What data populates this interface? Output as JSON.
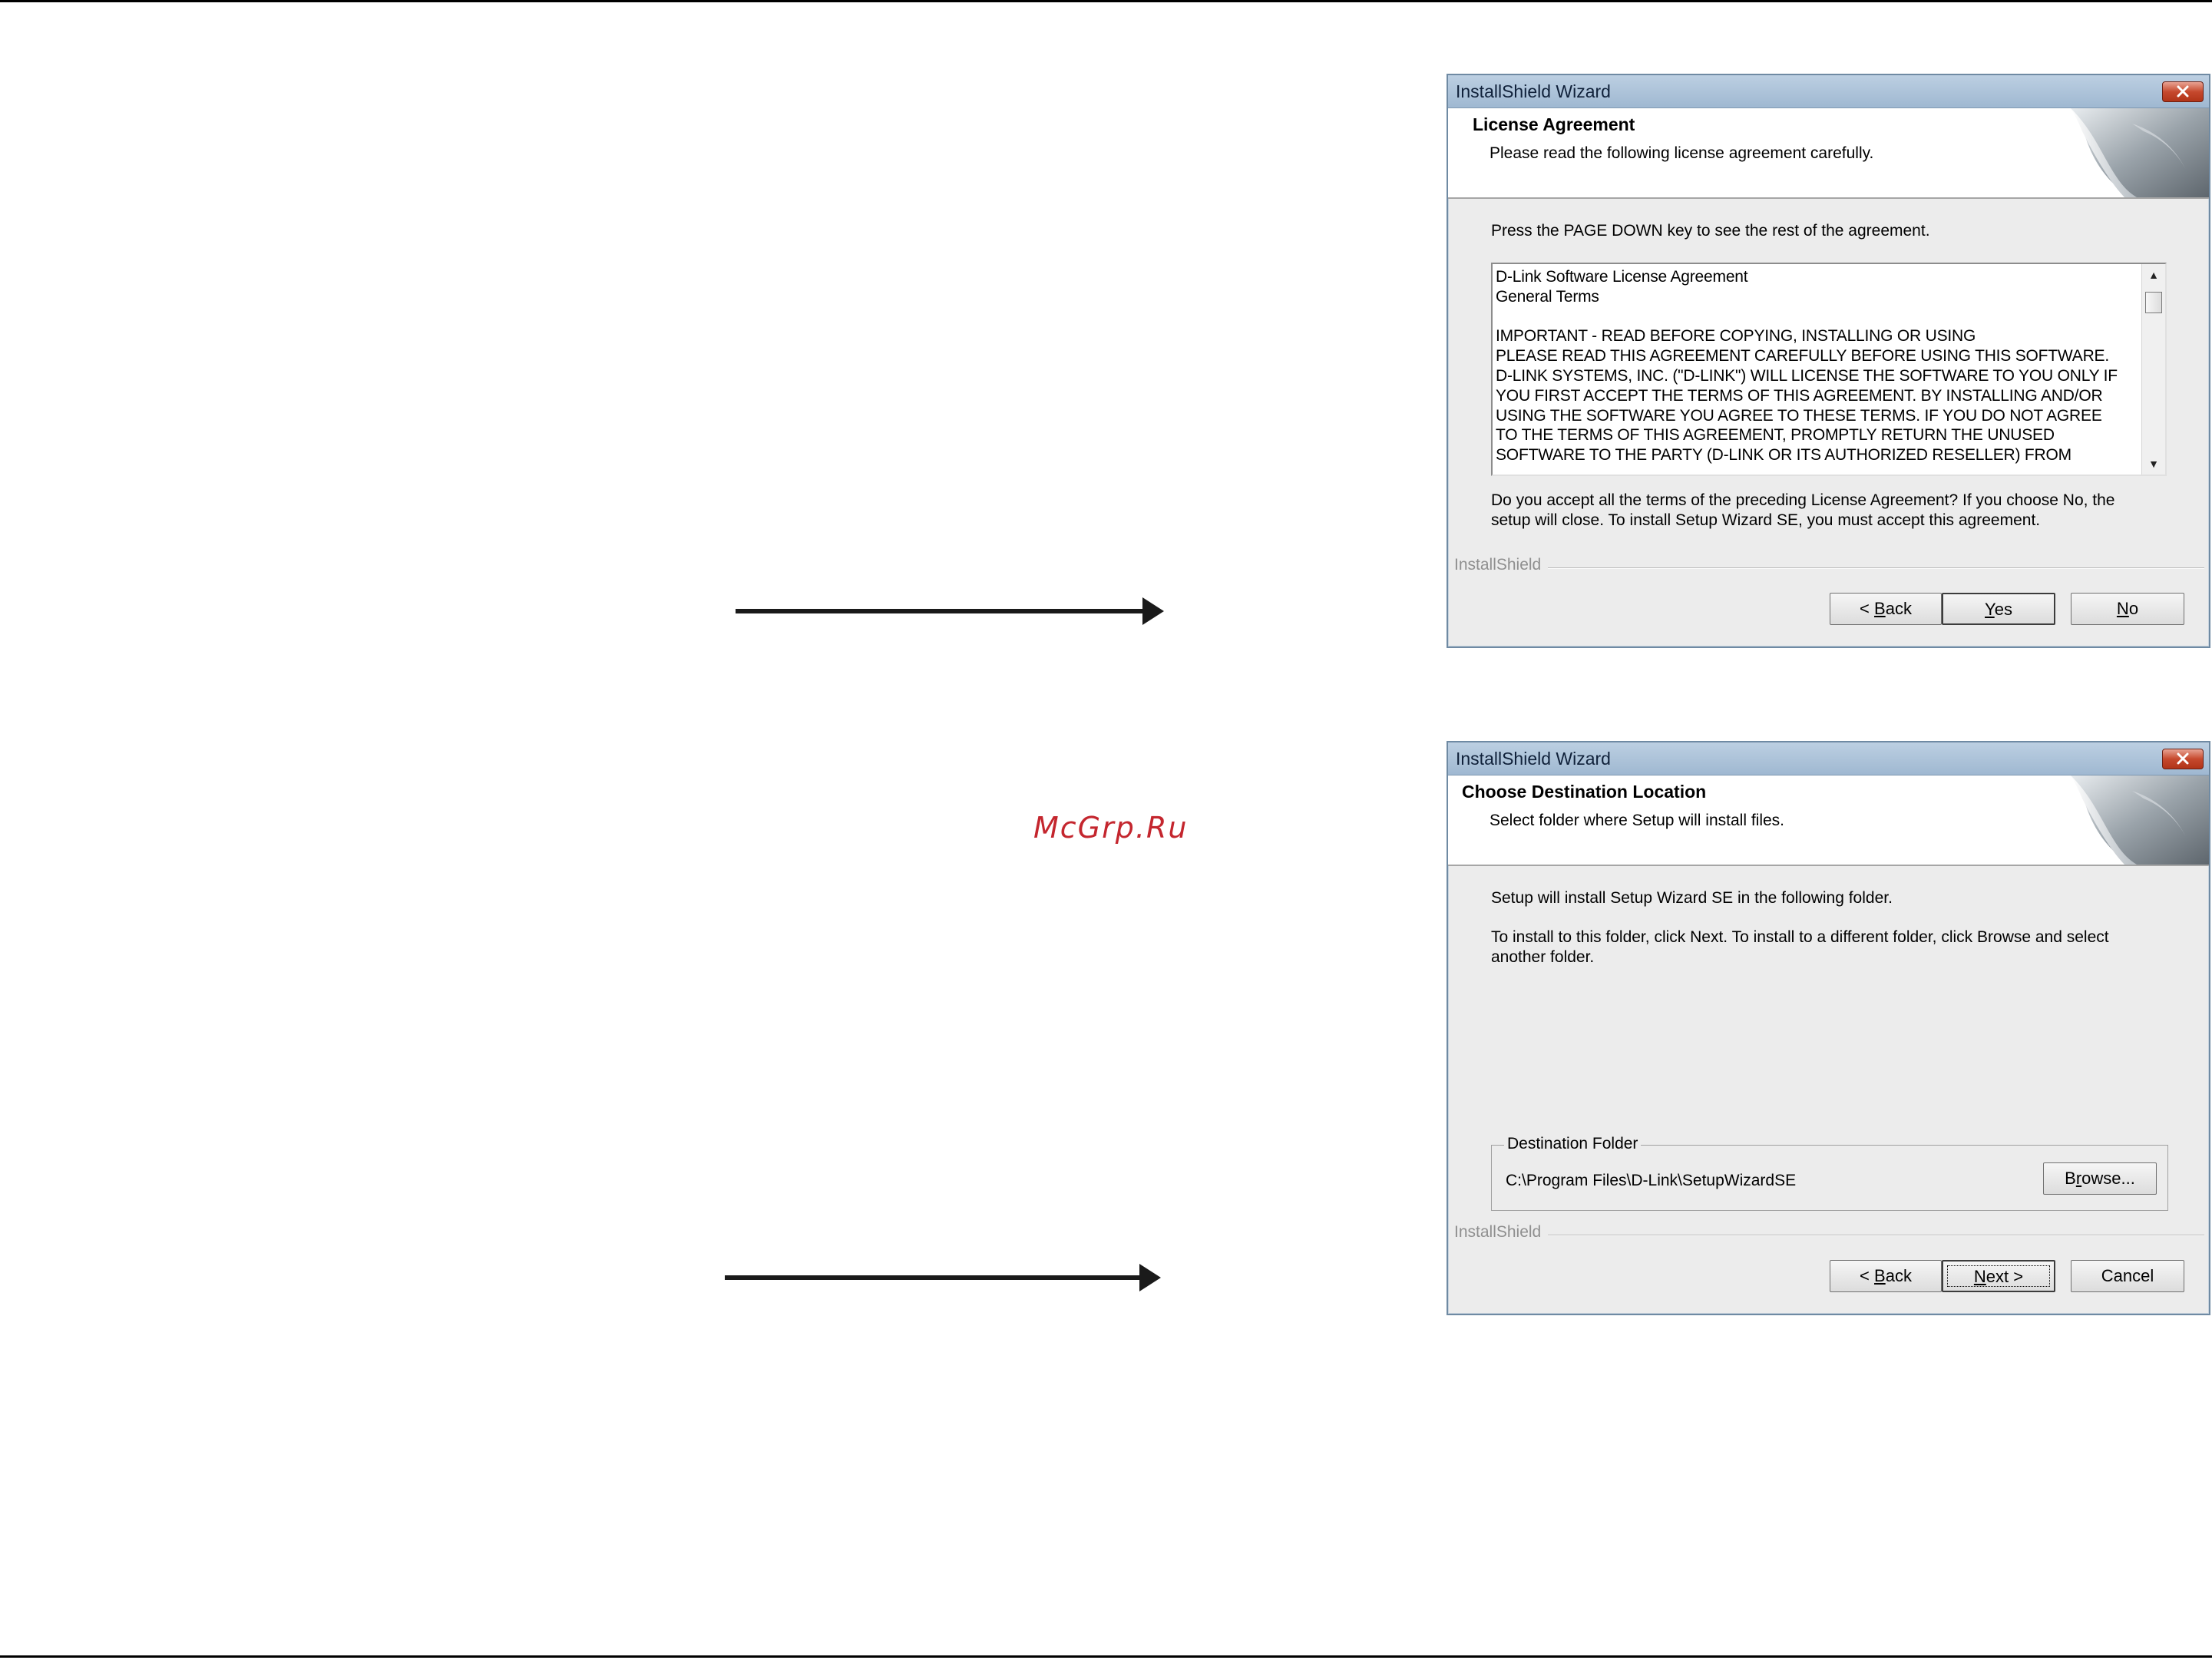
{
  "watermark": "McGrp.Ru",
  "dialogs": [
    {
      "window_title": "InstallShield Wizard",
      "header_title": "License Agreement",
      "header_subtitle": "Please read the following license agreement carefully.",
      "instruction": "Press the PAGE DOWN key to see the rest of the agreement.",
      "license_text": "D-Link Software License Agreement\nGeneral Terms\n\nIMPORTANT - READ BEFORE COPYING, INSTALLING OR USING\nPLEASE READ THIS AGREEMENT CAREFULLY BEFORE USING THIS SOFTWARE.\nD-LINK SYSTEMS, INC. (\"D-LINK\") WILL LICENSE THE SOFTWARE TO YOU ONLY IF\nYOU FIRST ACCEPT THE TERMS OF THIS AGREEMENT. BY INSTALLING AND/OR\nUSING THE SOFTWARE YOU AGREE TO THESE TERMS. IF YOU DO NOT AGREE\nTO THE TERMS OF THIS AGREEMENT, PROMPTLY RETURN THE UNUSED\nSOFTWARE TO THE PARTY (D-LINK OR ITS AUTHORIZED RESELLER) FROM",
      "question_line1": "Do you accept all the terms of the preceding License Agreement?  If you choose No,  the",
      "question_line2": "setup will close.  To install Setup Wizard SE, you must accept this agreement.",
      "footer_brand": "InstallShield",
      "buttons": {
        "back_mnemonic": "B",
        "back_rest": "ack",
        "back_prefix": "< ",
        "yes_mnemonic": "Y",
        "yes_rest": "es",
        "no_mnemonic": "N",
        "no_rest": "o"
      }
    },
    {
      "window_title": "InstallShield Wizard",
      "header_title": "Choose Destination Location",
      "header_subtitle": "Select folder where Setup will install files.",
      "instruction1": "Setup will install Setup Wizard SE in the following folder.",
      "instruction2_line1": "To install to this folder, click Next. To install to a different folder, click Browse and select",
      "instruction2_line2": "another folder.",
      "destination_legend": "Destination Folder",
      "destination_path": "C:\\Program Files\\D-Link\\SetupWizardSE",
      "footer_brand": "InstallShield",
      "buttons": {
        "browse_prefix": "B",
        "browse_mnemonic": "r",
        "browse_rest": "owse...",
        "back_prefix": "< ",
        "back_mnemonic": "B",
        "back_rest": "ack",
        "next_mnemonic": "N",
        "next_rest": "ext >",
        "cancel": "Cancel"
      }
    }
  ],
  "colors": {
    "titlebar": "#a9c0d8",
    "close_button": "#c6492e",
    "dialog_bg": "#ececec",
    "watermark": "#c4262e"
  }
}
